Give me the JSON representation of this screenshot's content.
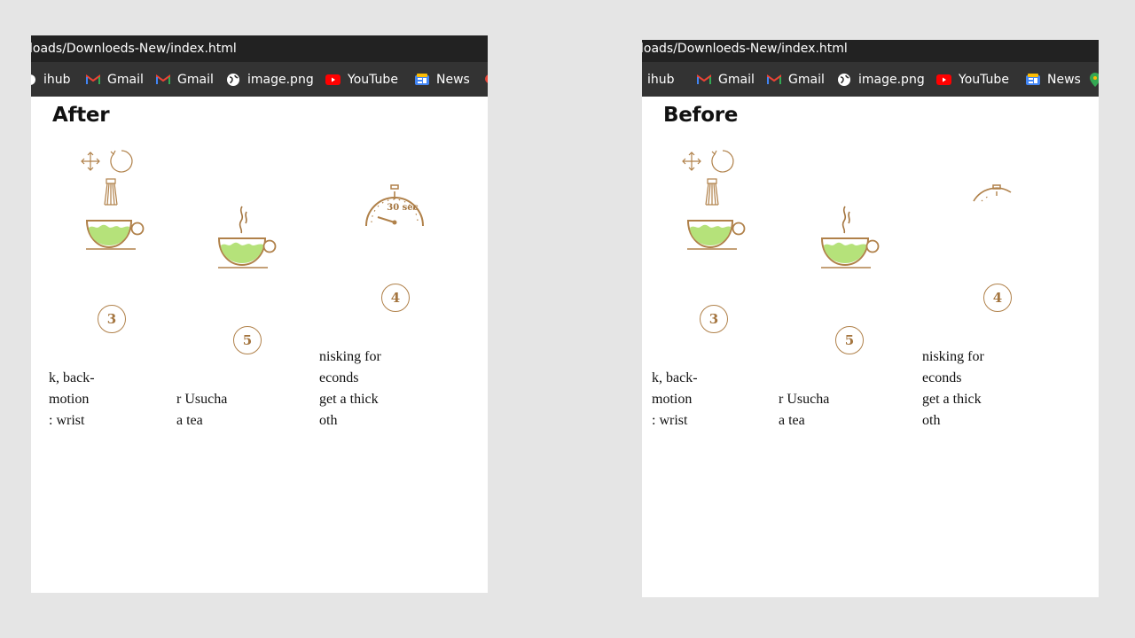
{
  "browser": {
    "url_fragment": "loads/Downloeds-New/index.html",
    "bookmarks": [
      {
        "label": "ihub",
        "icon": "github-icon"
      },
      {
        "label": "Gmail",
        "icon": "gmail-icon"
      },
      {
        "label": "Gmail",
        "icon": "gmail-icon"
      },
      {
        "label": "image.png",
        "icon": "globe-icon"
      },
      {
        "label": "YouTube",
        "icon": "youtube-icon"
      },
      {
        "label": "News",
        "icon": "google-news-icon"
      }
    ]
  },
  "after": {
    "title": "After",
    "steps": [
      {
        "number": "3",
        "caption": [
          "k, back-",
          "motion",
          ": wrist"
        ]
      },
      {
        "number": "5",
        "caption": [
          "r Usucha",
          "a tea"
        ]
      },
      {
        "number": "4",
        "timer_label": "30 sec",
        "caption": [
          "nisking for",
          "econds",
          "get a thick",
          "oth"
        ]
      }
    ]
  },
  "before": {
    "title": "Before",
    "steps": [
      {
        "number": "3",
        "caption": [
          "k, back-",
          "motion",
          ": wrist"
        ]
      },
      {
        "number": "5",
        "caption": [
          "r Usucha",
          "a tea"
        ]
      },
      {
        "number": "4",
        "caption": [
          "nisking for",
          "econds",
          "get a thick",
          "oth"
        ]
      }
    ]
  },
  "colors": {
    "accent": "#b0814a",
    "matcha": "#b5e27a",
    "toolbar": "#222222",
    "bookmarks_bar": "#333333"
  }
}
